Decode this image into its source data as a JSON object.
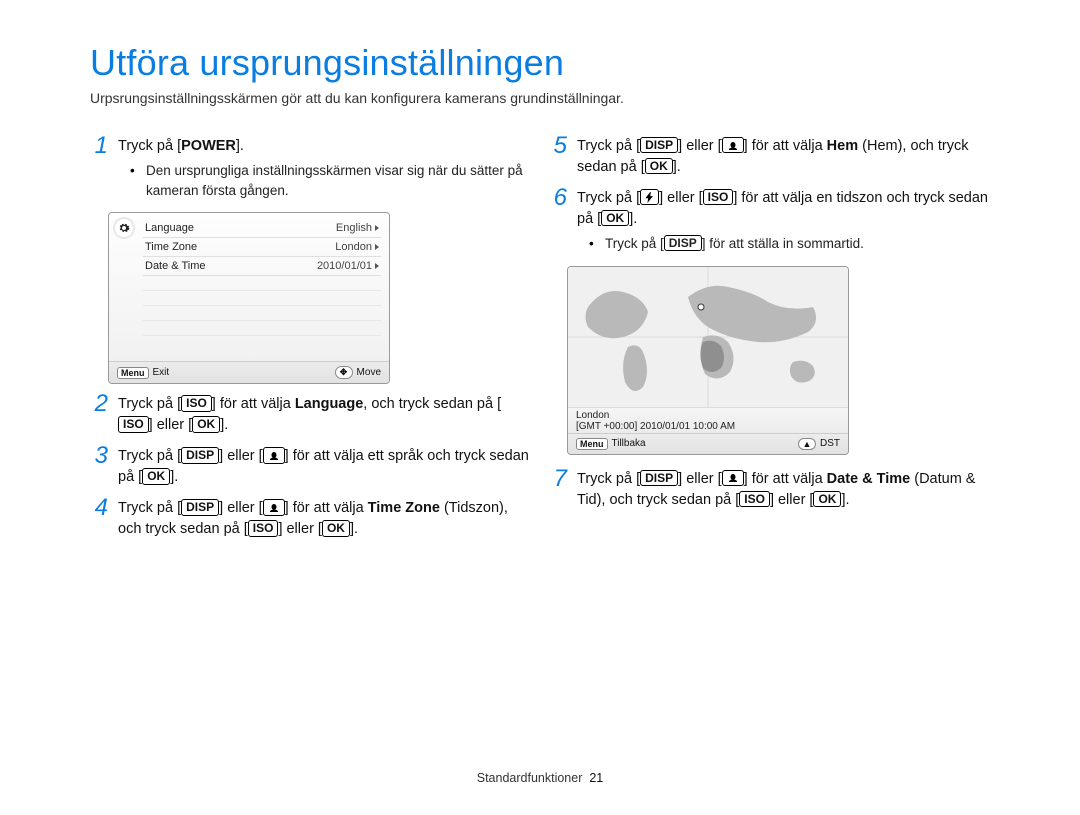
{
  "title": "Utföra ursprungsinställningen",
  "subtitle": "Urpsrungsinställningsskärmen gör att du kan konfigurera kamerans grundinställningar.",
  "keys": {
    "power": "POWER",
    "iso": "ISO",
    "ok": "OK",
    "disp": "DISP",
    "menu": "Menu"
  },
  "steps": {
    "s1": {
      "num": "1",
      "pre": "Tryck på [",
      "label": "POWER",
      "post": "].",
      "bullet": "Den ursprungliga inställningsskärmen visar sig när du sätter på kameran första gången."
    },
    "s2": {
      "num": "2",
      "t1": "Tryck på [",
      "t2": "] för att välja ",
      "lang": "Language",
      "t3": ", och tryck sedan på [",
      "t4": "] eller [",
      "t5": "]."
    },
    "s3": {
      "num": "3",
      "t1": "Tryck på [",
      "t2": "] eller [",
      "t3": "] för att välja ett språk och tryck sedan på [",
      "t4": "]."
    },
    "s4": {
      "num": "4",
      "t1": "Tryck på [",
      "t2": "] eller [",
      "tz": "Time Zone",
      "t3": "] för att välja ",
      "t4": " (Tidszon), och tryck sedan på [",
      "t5": "] eller [",
      "t6": "]."
    },
    "s5": {
      "num": "5",
      "t1": "Tryck på [",
      "t2": "] eller [",
      "hem": "Hem",
      "t3": "] för att välja ",
      "t4": " (Hem), och tryck sedan på [",
      "t5": "]."
    },
    "s6": {
      "num": "6",
      "t1": "Tryck på [",
      "t2": "] eller [",
      "t3": "] för att välja en tidszon och tryck sedan på [",
      "t4": "].",
      "bullet_t1": "Tryck på [",
      "bullet_t2": "] för att ställa in sommartid."
    },
    "s7": {
      "num": "7",
      "t1": "Tryck på [",
      "t2": "] eller [",
      "dt": "Date & Time",
      "t3": "] för att välja ",
      "t4": " (Datum & Tid), och tryck sedan på [",
      "t5": "] eller [",
      "t6": "]."
    }
  },
  "lcd": {
    "rows": [
      {
        "label": "Language",
        "value": "English"
      },
      {
        "label": "Time Zone",
        "value": "London"
      },
      {
        "label": "Date & Time",
        "value": "2010/01/01"
      }
    ],
    "bar": {
      "left_badge": "Menu",
      "left_text": "Exit",
      "right_text": "Move"
    }
  },
  "map": {
    "city": "London",
    "gmt": "[GMT +00:00] 2010/01/01 10:00 AM",
    "bar": {
      "left_badge": "Menu",
      "left_text": "Tillbaka",
      "right_text": "DST"
    }
  },
  "footer": {
    "label": "Standardfunktioner",
    "page": "21"
  }
}
